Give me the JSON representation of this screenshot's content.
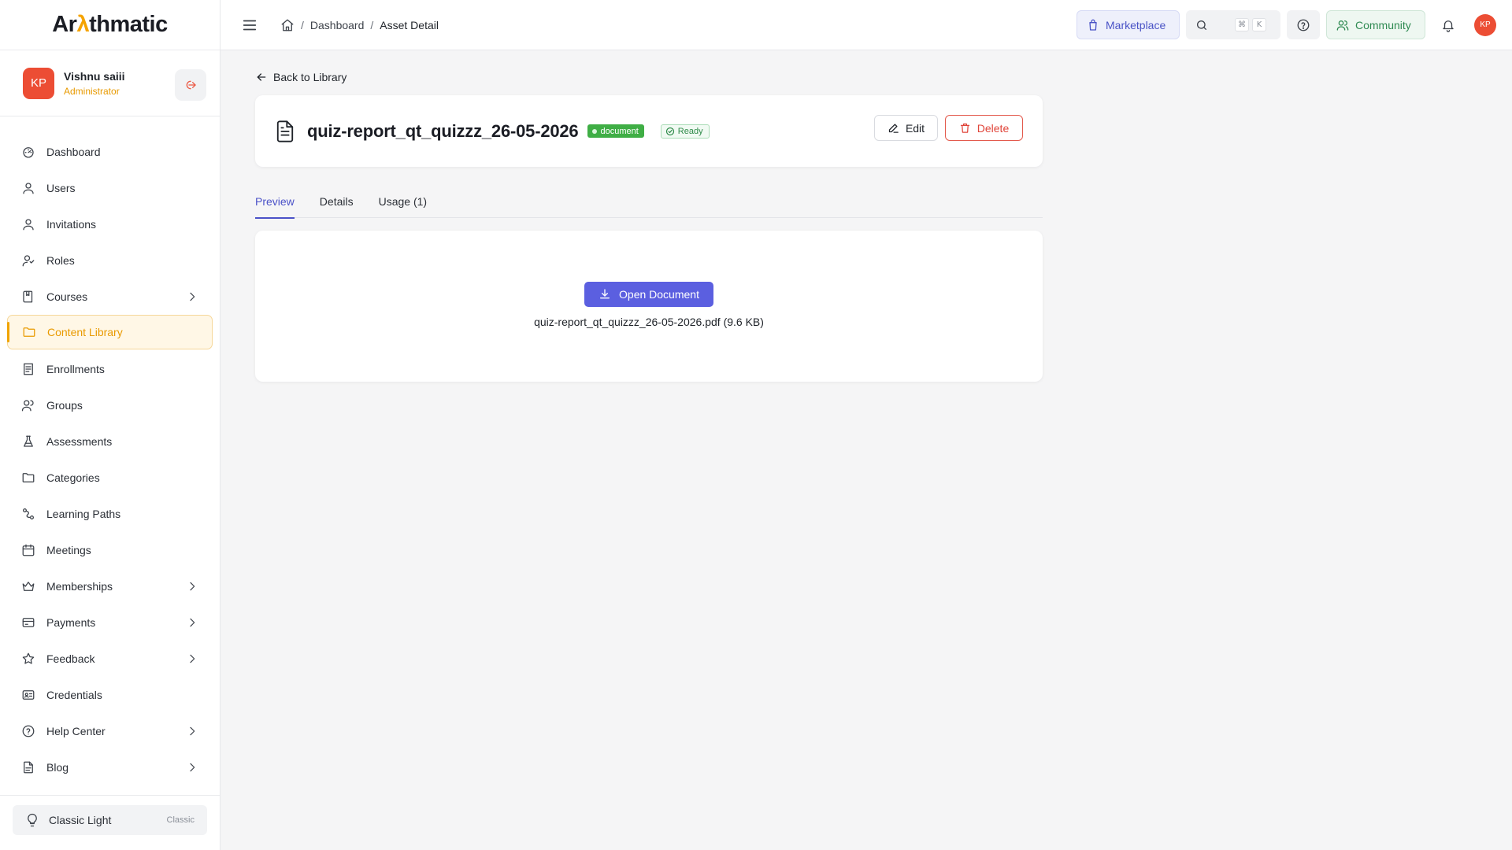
{
  "brand": {
    "logo_prefix": "Ar",
    "logo_accent": "λ",
    "logo_suffix": "thmatic",
    "accent_color": "#f5a300"
  },
  "user": {
    "initials": "KP",
    "name": "Vishnu saiii",
    "role": "Administrator"
  },
  "sidebar": {
    "items": [
      {
        "label": "Dashboard",
        "icon": "gauge-icon",
        "has_children": false
      },
      {
        "label": "Users",
        "icon": "user-icon",
        "has_children": false
      },
      {
        "label": "Invitations",
        "icon": "user-icon",
        "has_children": false
      },
      {
        "label": "Roles",
        "icon": "user-roles-icon",
        "has_children": false
      },
      {
        "label": "Courses",
        "icon": "book-icon",
        "has_children": true
      },
      {
        "label": "Content Library",
        "icon": "folder-icon",
        "has_children": false,
        "active": true
      },
      {
        "label": "Enrollments",
        "icon": "list-icon",
        "has_children": false
      },
      {
        "label": "Groups",
        "icon": "users-icon",
        "has_children": false
      },
      {
        "label": "Assessments",
        "icon": "flask-icon",
        "has_children": false
      },
      {
        "label": "Categories",
        "icon": "folder-icon",
        "has_children": false
      },
      {
        "label": "Learning Paths",
        "icon": "route-icon",
        "has_children": false
      },
      {
        "label": "Meetings",
        "icon": "calendar-icon",
        "has_children": false
      },
      {
        "label": "Memberships",
        "icon": "crown-icon",
        "has_children": true
      },
      {
        "label": "Payments",
        "icon": "credit-card-icon",
        "has_children": true
      },
      {
        "label": "Feedback",
        "icon": "star-icon",
        "has_children": true
      },
      {
        "label": "Credentials",
        "icon": "id-card-icon",
        "has_children": false
      },
      {
        "label": "Help Center",
        "icon": "help-circle-icon",
        "has_children": true
      },
      {
        "label": "Blog",
        "icon": "file-text-icon",
        "has_children": true
      }
    ],
    "theme": {
      "label": "Classic Light",
      "tag": "Classic"
    }
  },
  "header": {
    "breadcrumb": [
      "Dashboard",
      "Asset Detail"
    ],
    "marketplace_label": "Marketplace",
    "search_shortcut": [
      "⌘",
      "K"
    ],
    "community_label": "Community",
    "avatar_initials": "KP"
  },
  "asset": {
    "back_label": "Back to Library",
    "title": "quiz-report_qt_quizzz_26-05-2026",
    "type_badge": "document",
    "status_badge": "Ready",
    "edit_label": "Edit",
    "delete_label": "Delete"
  },
  "tabs": [
    {
      "label": "Preview",
      "active": true
    },
    {
      "label": "Details",
      "active": false
    },
    {
      "label": "Usage (1)",
      "active": false
    }
  ],
  "preview": {
    "open_label": "Open Document",
    "file_line": "quiz-report_qt_quizzz_26-05-2026.pdf (9.6 KB)"
  }
}
